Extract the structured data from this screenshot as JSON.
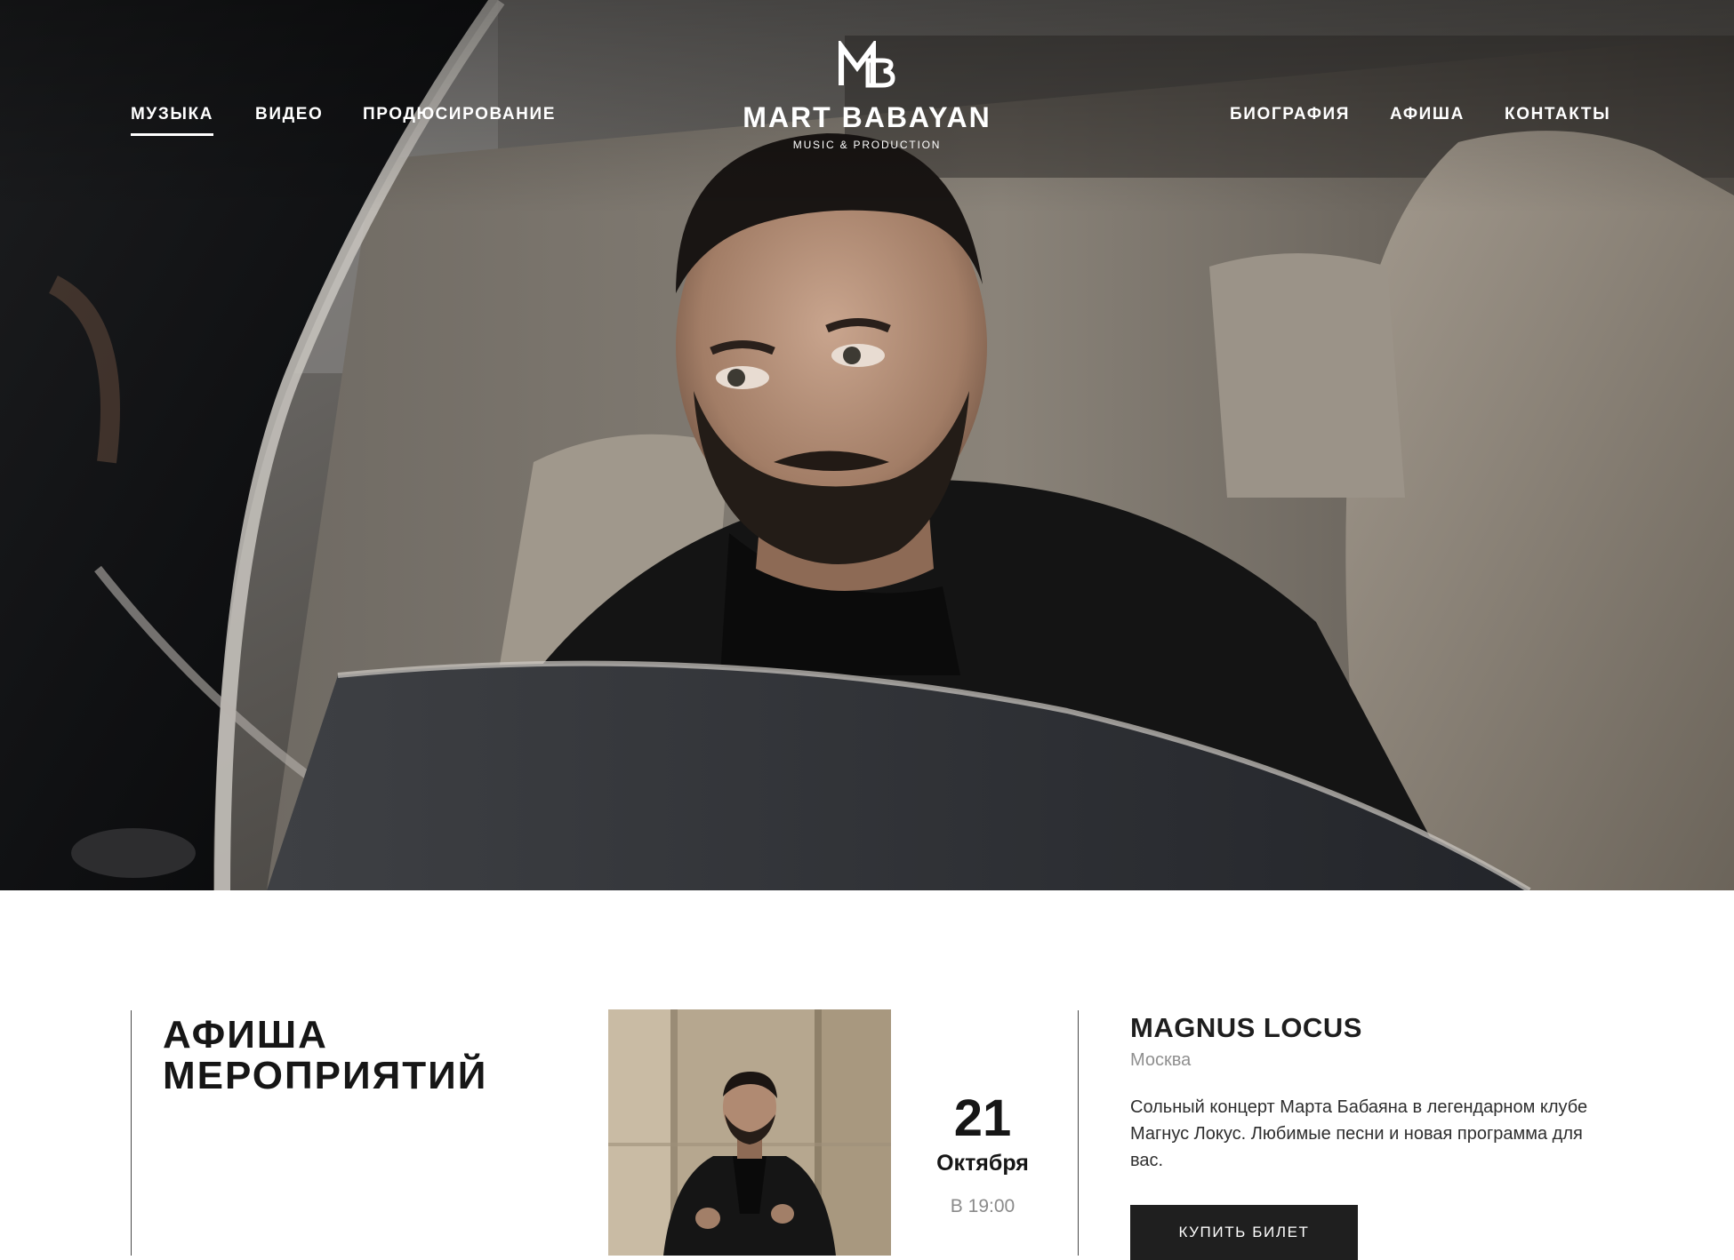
{
  "nav": {
    "left": [
      {
        "label": "МУЗЫКА",
        "active": true
      },
      {
        "label": "ВИДЕО",
        "active": false
      },
      {
        "label": "ПРОДЮСИРОВАНИЕ",
        "active": false
      }
    ],
    "right": [
      {
        "label": "БИОГРАФИЯ",
        "active": false
      },
      {
        "label": "АФИША",
        "active": false
      },
      {
        "label": "КОНТАКТЫ",
        "active": false
      }
    ]
  },
  "logo": {
    "monogram": "MB",
    "name": "MART BABAYAN",
    "tagline": "MUSIC & PRODUCTION"
  },
  "afisha": {
    "title_line1": "АФИША",
    "title_line2": "МЕРОПРИЯТИЙ",
    "event": {
      "day": "21",
      "month": "Октября",
      "time": "В 19:00",
      "title": "MAGNUS LOCUS",
      "city": "Москва",
      "description": "Сольный концерт Марта Бабаяна в легендарном клубе Магнус Локус. Любимые песни и новая программа для вас.",
      "button_label": "КУПИТЬ БИЛЕТ"
    }
  },
  "colors": {
    "nav_text": "#ffffff",
    "button_bg": "#1f1f1f",
    "muted_text": "#8f8f8f",
    "heading": "#161616"
  }
}
